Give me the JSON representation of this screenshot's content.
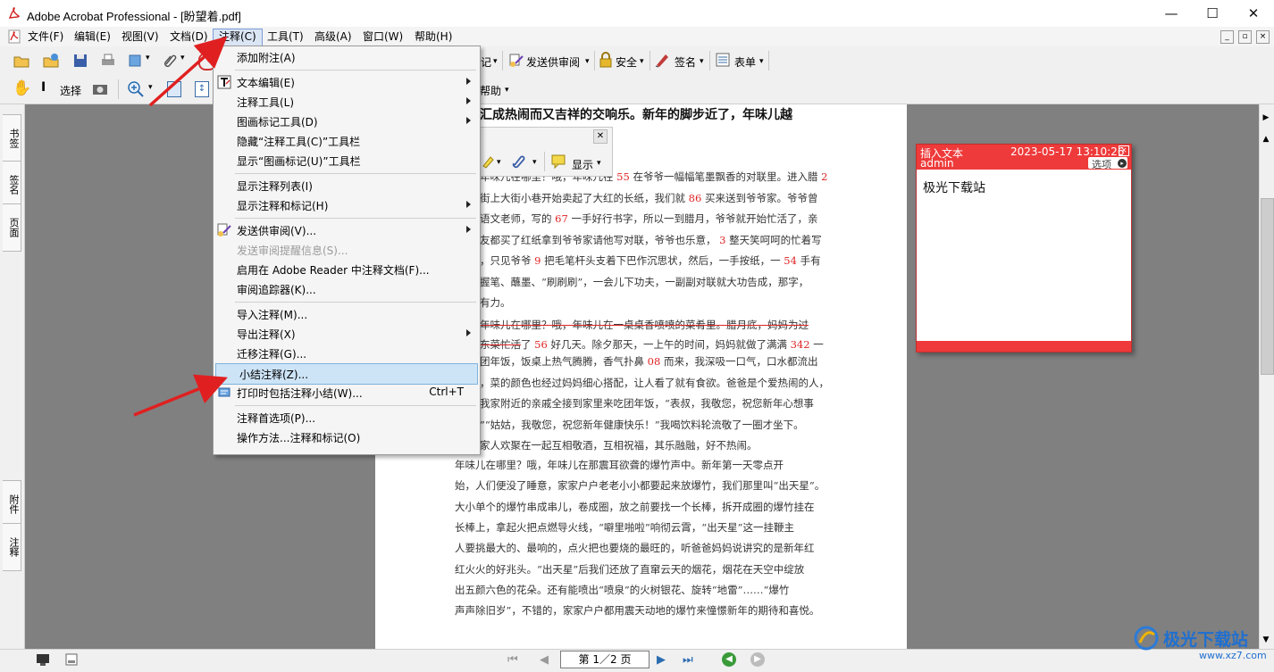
{
  "window": {
    "title": "Adobe Acrobat Professional - [盼望着.pdf]",
    "minimize": "—",
    "maximize": "☐",
    "close": "✕"
  },
  "menubar": {
    "items": [
      "文件(F)",
      "编辑(E)",
      "视图(V)",
      "文档(D)",
      "注释(C)",
      "工具(T)",
      "高级(A)",
      "窗口(W)",
      "帮助(H)"
    ],
    "active": "注释(C)"
  },
  "toolbar1": {
    "truncated_label": "记",
    "send_review": "发送供审阅",
    "security": "安全",
    "sign": "签名",
    "forms": "表单"
  },
  "toolbar2": {
    "select": "选择",
    "help": "帮助"
  },
  "float_toolbar": {
    "show": "显示"
  },
  "side_tabs": {
    "top": [
      "书签",
      "签名",
      "页面"
    ],
    "bottom": [
      "附件",
      "注释"
    ]
  },
  "dropdown": {
    "items": [
      {
        "label": "添加附注(A)",
        "has_icon": false
      },
      {
        "label": "文本编辑(E)",
        "submenu": true,
        "icon": "text-edit-icon"
      },
      {
        "label": "注释工具(L)",
        "submenu": true
      },
      {
        "label": "图画标记工具(D)",
        "submenu": true
      },
      {
        "label": "隐藏“注释工具(C)”工具栏"
      },
      {
        "label": "显示“图画标记(U)”工具栏"
      },
      {
        "label": "显示注释列表(I)"
      },
      {
        "label": "显示注释和标记(H)",
        "submenu": true
      },
      {
        "label": "发送供审阅(V)...",
        "submenu": true,
        "icon": "send-review-icon"
      },
      {
        "label": "发送审阅提醒信息(S)...",
        "disabled": true
      },
      {
        "label": "启用在 Adobe Reader 中注释文档(F)..."
      },
      {
        "label": "审阅追踪器(K)..."
      },
      {
        "label": "导入注释(M)..."
      },
      {
        "label": "导出注释(X)",
        "submenu": true
      },
      {
        "label": "迁移注释(G)..."
      },
      {
        "label": "小结注释(Z)...",
        "highlight": true
      },
      {
        "label": "打印时包括注释小结(W)...",
        "shortcut": "Ctrl+T",
        "icon": "print-summary-icon"
      },
      {
        "label": "注释首选项(P)..."
      },
      {
        "label": "操作方法...注释和标记(O)"
      }
    ]
  },
  "note": {
    "type": "插入文本",
    "timestamp": "2023-05-17 13:10:26",
    "author": "admin",
    "options": "选项",
    "content": "极光下载站",
    "close": "✕"
  },
  "document": {
    "heading": "汇成热闹而又吉祥的交响乐。新年的脚步近了，年味儿越",
    "lines": [
      [
        "年味儿在哪里？哦，年味儿在",
        "55",
        "在爷爷一幅幅笔墨飘香的对联里。进入腊",
        "2"
      ],
      [
        "街上大街小巷开始卖起了大红的长纸，我们就",
        "86",
        "买来送到爷爷家。爷爷曾"
      ],
      [
        "语文老师，写的",
        "67",
        "一手好行书字，所以一到腊月，爷爷就开始忙活了，亲"
      ],
      [
        "友都买了红纸拿到爷爷家请他写对联，爷爷也乐意，",
        "3",
        "整天笑呵呵的忙着写"
      ],
      [
        "，只见爷爷",
        "9",
        "把毛笔杆头支着下巴作沉思状，然后，一手按纸，一",
        "54",
        "手有"
      ],
      [
        "握笔、蘸墨、“刷刷刷”，一会儿下功夫，一副副对联就大功告成，那字，"
      ],
      [
        "有力。"
      ]
    ],
    "strike_line_1": "年味儿在哪里？哦，年味儿在一桌桌香喷喷的菜肴里。腊月底，妈妈为过",
    "strike_line_2_a": "东菜忙活",
    "strike_line_2_b": "了",
    "strike_line_2_num": "56",
    "strike_line_2_c": "好几天。除夕那天，一上午的时间，妈妈就做了满满",
    "strike_line_2_num2": "342",
    "strike_line_2_d": "一",
    "lines2": [
      [
        "团年饭，饭桌上热气腾腾，香气扑鼻",
        "08",
        "而来，我深吸一口气，口水都流出"
      ],
      [
        "，菜的颜色也经过妈妈细心搭配，让人看了就有食欲。爸爸是个爱热闹的人，"
      ],
      [
        "我家附近的亲戚全接到家里来吃团年饭，“表叔，我敬您，祝您新年心想事"
      ],
      [
        "”“姑姑，我敬您，祝您新年健康快乐！”我喝饮料轮流敬了一圈才坐下。"
      ],
      [
        "家人欢聚在一起互相敬酒，互相祝福，其乐融融，好不热闹。"
      ]
    ],
    "para3": [
      "年味儿在哪里？哦，年味儿在那震耳欲聋的爆竹声中。新年第一天零点开",
      "始，人们便没了睡意，家家户户老老小小都要起来放爆竹，我们那里叫“出天星”。",
      "大小单个的爆竹串成串儿，卷成圈，放之前要找一个长棒，拆开成圈的爆竹挂在",
      "长棒上，拿起火把点燃导火线，“噼里啪啦”响彻云霄，“出天星”这一挂鞭主",
      "人要挑最大的、最响的，点火把也要烧的最旺的，听爸爸妈妈说讲究的是新年红",
      "红火火的好兆头。“出天星”后我们还放了直窜云天的烟花，烟花在天空中绽放",
      "出五颜六色的花朵。还有能喷出“喷泉”的火树银花、旋转“地雷”……“爆竹",
      "声声除旧岁”，不错的，家家户户都用震天动地的爆竹来憧憬新年的期待和喜悦。"
    ]
  },
  "statusbar": {
    "page_indicator": "第 1／2 页"
  },
  "watermark": {
    "text": "极光下载站",
    "url": "www.xz7.com"
  },
  "colors": {
    "note_header": "#ee3a3a",
    "menu_highlight": "#cde4f7",
    "doc_background": "#808080",
    "arrow": "#e02020"
  }
}
